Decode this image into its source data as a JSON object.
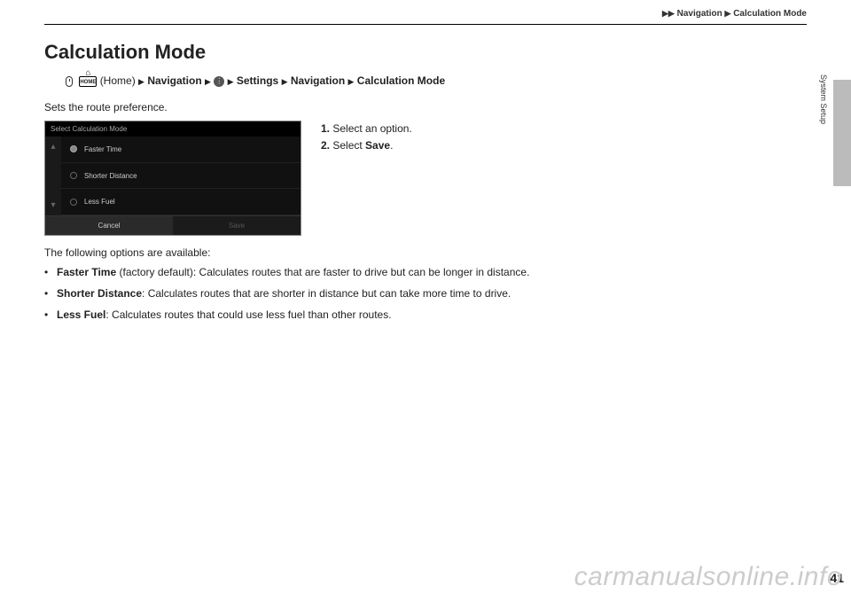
{
  "breadcrumb": {
    "a": "Navigation",
    "b": "Calculation Mode"
  },
  "title": "Calculation Mode",
  "navpath": {
    "home_label": "(Home)",
    "nav": "Navigation",
    "settings": "Settings",
    "nav2": "Navigation",
    "calc_mode": "Calculation Mode"
  },
  "intro": "Sets the route preference.",
  "shot": {
    "title": "Select Calculation Mode",
    "opt1": "Faster Time",
    "opt2": "Shorter Distance",
    "opt3": "Less Fuel",
    "cancel": "Cancel",
    "save": "Save"
  },
  "steps": {
    "s1_num": "1.",
    "s1": "Select an option.",
    "s2_num": "2.",
    "s2_pre": "Select ",
    "s2_bold": "Save",
    "s2_post": "."
  },
  "opts_intro": "The following options are available:",
  "opts": {
    "o1_bold": "Faster Time",
    "o1_rest": " (factory default): Calculates routes that are faster to drive but can be longer in distance.",
    "o2_bold": "Shorter Distance",
    "o2_rest": ": Calculates routes that are shorter in distance but can take more time to drive.",
    "o3_bold": "Less Fuel",
    "o3_rest": ": Calculates routes that could use less fuel than other routes."
  },
  "section_tab": "System Setup",
  "page_number": "41",
  "watermark": "carmanualsonline.info"
}
